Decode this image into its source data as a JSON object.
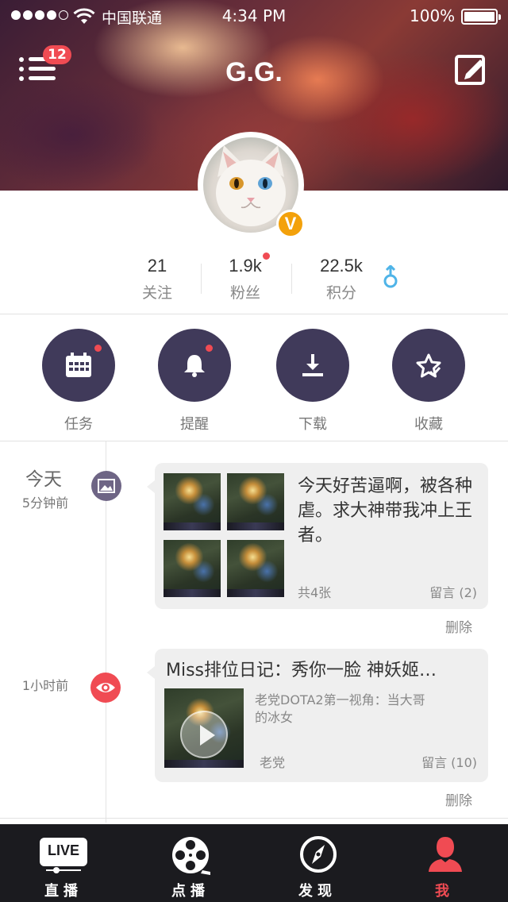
{
  "status_bar": {
    "carrier": "中国联通",
    "time": "4:34 PM",
    "battery": "100%"
  },
  "header": {
    "title": "G.G.",
    "menu_badge": "12",
    "menu_icon": "menu-icon",
    "edit_icon": "edit-icon"
  },
  "profile": {
    "verified_badge": "V",
    "stats": [
      {
        "value": "21",
        "label": "关注"
      },
      {
        "value": "1.9k",
        "label": "粉丝"
      },
      {
        "value": "22.5k",
        "label": "积分"
      }
    ],
    "gender_icon": "male-icon"
  },
  "actions": [
    {
      "label": "任务",
      "icon": "calendar-icon"
    },
    {
      "label": "提醒",
      "icon": "bell-icon"
    },
    {
      "label": "下载",
      "icon": "download-icon"
    },
    {
      "label": "收藏",
      "icon": "star-icon"
    }
  ],
  "colors": {
    "accent": "#f04b53",
    "circle": "#403a5a",
    "verified": "#f3a10b",
    "tabbar": "#1b1b1f"
  },
  "timeline": [
    {
      "date": "今天",
      "time": "5分钟前",
      "type_icon": "image-icon",
      "text": "今天好苦逼啊，被各种虐。求大神带我冲上王者。",
      "photo_count": "共4张",
      "comments": "留言 (2)",
      "delete": "删除"
    },
    {
      "time": "1小时前",
      "type_icon": "eye-icon",
      "title": "Miss排位日记：秀你一脸 神妖姬…",
      "desc": "老党DOTA2第一视角：当大哥的冰女",
      "author": "老党",
      "comments": "留言 (10)",
      "delete": "删除"
    }
  ],
  "tabbar": [
    {
      "label": "直播",
      "icon": "live-icon",
      "live_text": "LIVE"
    },
    {
      "label": "点播",
      "icon": "film-reel-icon"
    },
    {
      "label": "发现",
      "icon": "compass-icon"
    },
    {
      "label": "我",
      "icon": "user-icon",
      "active": true
    }
  ]
}
